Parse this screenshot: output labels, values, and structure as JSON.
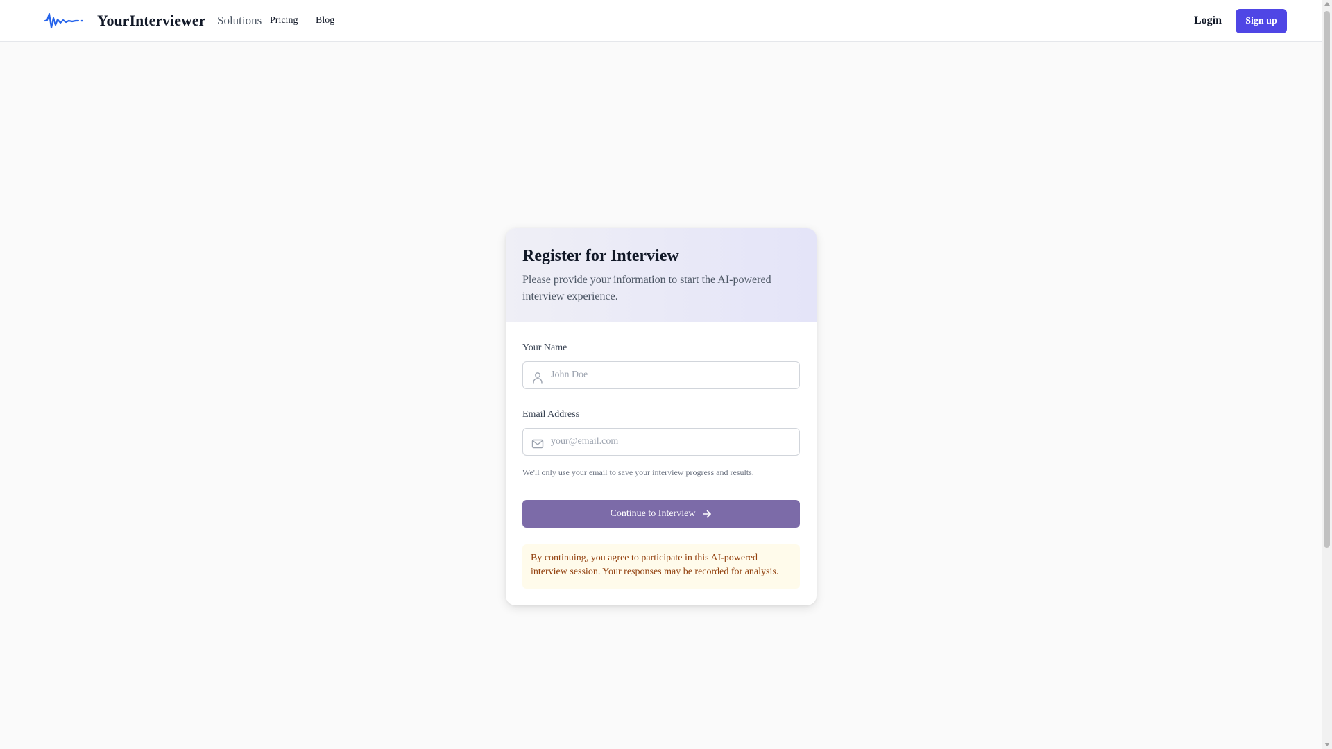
{
  "header": {
    "brand": "YourInterviewer",
    "nav": {
      "solutions": "Solutions",
      "pricing": "Pricing",
      "blog": "Blog"
    },
    "login": "Login",
    "signup": "Sign up"
  },
  "card": {
    "title": "Register for Interview",
    "description": "Please provide your information to start the AI-powered interview experience.",
    "name_field": {
      "label": "Your Name",
      "placeholder": "John Doe",
      "value": "",
      "icon": "user-icon"
    },
    "email_field": {
      "label": "Email Address",
      "placeholder": "your@email.com",
      "value": "",
      "icon": "mail-icon",
      "hint": "We'll only use your email to save your interview progress and results."
    },
    "continue_button": "Continue to Interview",
    "notice": "By continuing, you agree to participate in this AI-powered interview session. Your responses may be recorded for analysis."
  },
  "colors": {
    "brand_accent": "#4f46e5",
    "logo_wave": "#2563eb",
    "continue_button": "#7c6ba8",
    "header_gradient_start": "#efeff6",
    "header_gradient_end": "#e4e4f8",
    "notice_background": "#fffbeb",
    "notice_text": "#92400e"
  }
}
